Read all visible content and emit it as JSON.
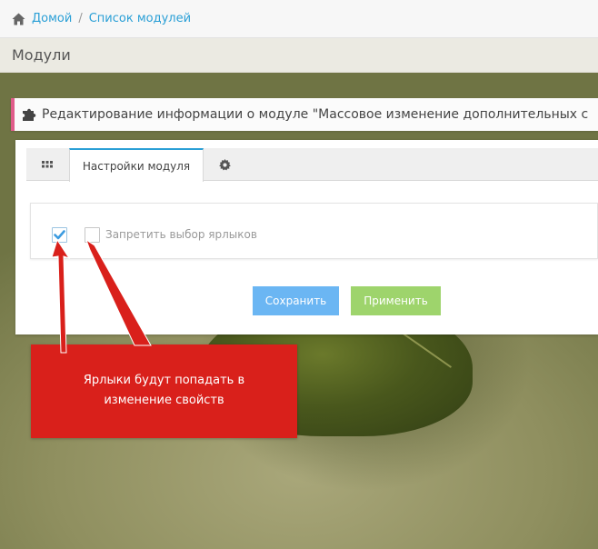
{
  "breadcrumb": {
    "home_label": "Домой",
    "separator": "/",
    "current_label": "Список модулей",
    "home_icon": "home-icon"
  },
  "page_header": {
    "title": "Модули"
  },
  "widget": {
    "title": "Редактирование информации о модуле \"Массовое изменение дополнительных с",
    "title_icon": "puzzle-icon"
  },
  "tabs": {
    "grid_icon": "grid-icon",
    "settings_label": "Настройки модуля",
    "gear_icon": "gear-icon"
  },
  "form": {
    "checkbox_label": "Запретить выбор ярлыков",
    "checkbox_checked": false,
    "annotation_checkbox_checked": true
  },
  "buttons": {
    "save_label": "Сохранить",
    "apply_label": "Применить"
  },
  "callout": {
    "line1": "Ярлыки будут попадать в",
    "line2": "изменение свойств"
  },
  "colors": {
    "accent_blue": "#2a9fd6",
    "save_button": "#6bb6f3",
    "apply_button": "#9ed46c",
    "callout_red": "#d9201b",
    "widget_title_border": "#e05c8a"
  }
}
